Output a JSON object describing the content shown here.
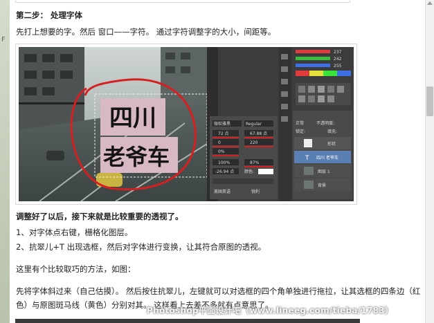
{
  "step": {
    "heading": "第二步： 处理字体",
    "intro": "先打上想要的字。然后 窗口——字符。 通过字符调整字的大小，间距等。"
  },
  "screenshot": {
    "sign_line1": "四川",
    "sign_line2": "老爷车",
    "char_panel": {
      "font_name": "微软雅黑",
      "font_style": "Regular",
      "size": "72 点",
      "leading": "67.88 点",
      "kerning": "0",
      "tracking": "220",
      "scale_v": "0%",
      "scale_h": "100%",
      "baseline": "87%",
      "shift": "-26.94 点",
      "color_label": "颜色:",
      "lang": "美国英语",
      "aa": "锐利"
    },
    "layers_panel": {
      "mode": "正常",
      "opacity_label": "不透明度:",
      "fill_label": "填充:",
      "lock_label": "锁定:",
      "layers": [
        "形状",
        "四川 老爷车",
        "图层 1",
        "背景"
      ]
    },
    "color_values": [
      "237",
      "242",
      "255"
    ],
    "colors": {
      "swatch_red": "#e33b3b",
      "sign_pink": "#d8b8c4",
      "annotation_red": "#d42020"
    }
  },
  "body": {
    "line1": "调整好了以后，接下来就是比较重要的透视了。",
    "line2": "1、对字体点右键，栅格化图层。",
    "line3": "2、抗翠儿+T 出现选框，然后对字体进行变换，让其符合原图的透视。",
    "line4": "这里有个比较取巧的方法，如图：",
    "line5": "先将字体斜过来（自己估摸）。 然后按住抗翠儿，左键就可以对选框的四个角单独进行拖拉，让其选框的四条边（红",
    "line6": "色）与原图斑马线（黄色）分别对其。 这样看上去差不多就有点意思了。"
  },
  "watermark": "Photoshop平面设计吧（www.lineeg.com/tieba/1783）"
}
